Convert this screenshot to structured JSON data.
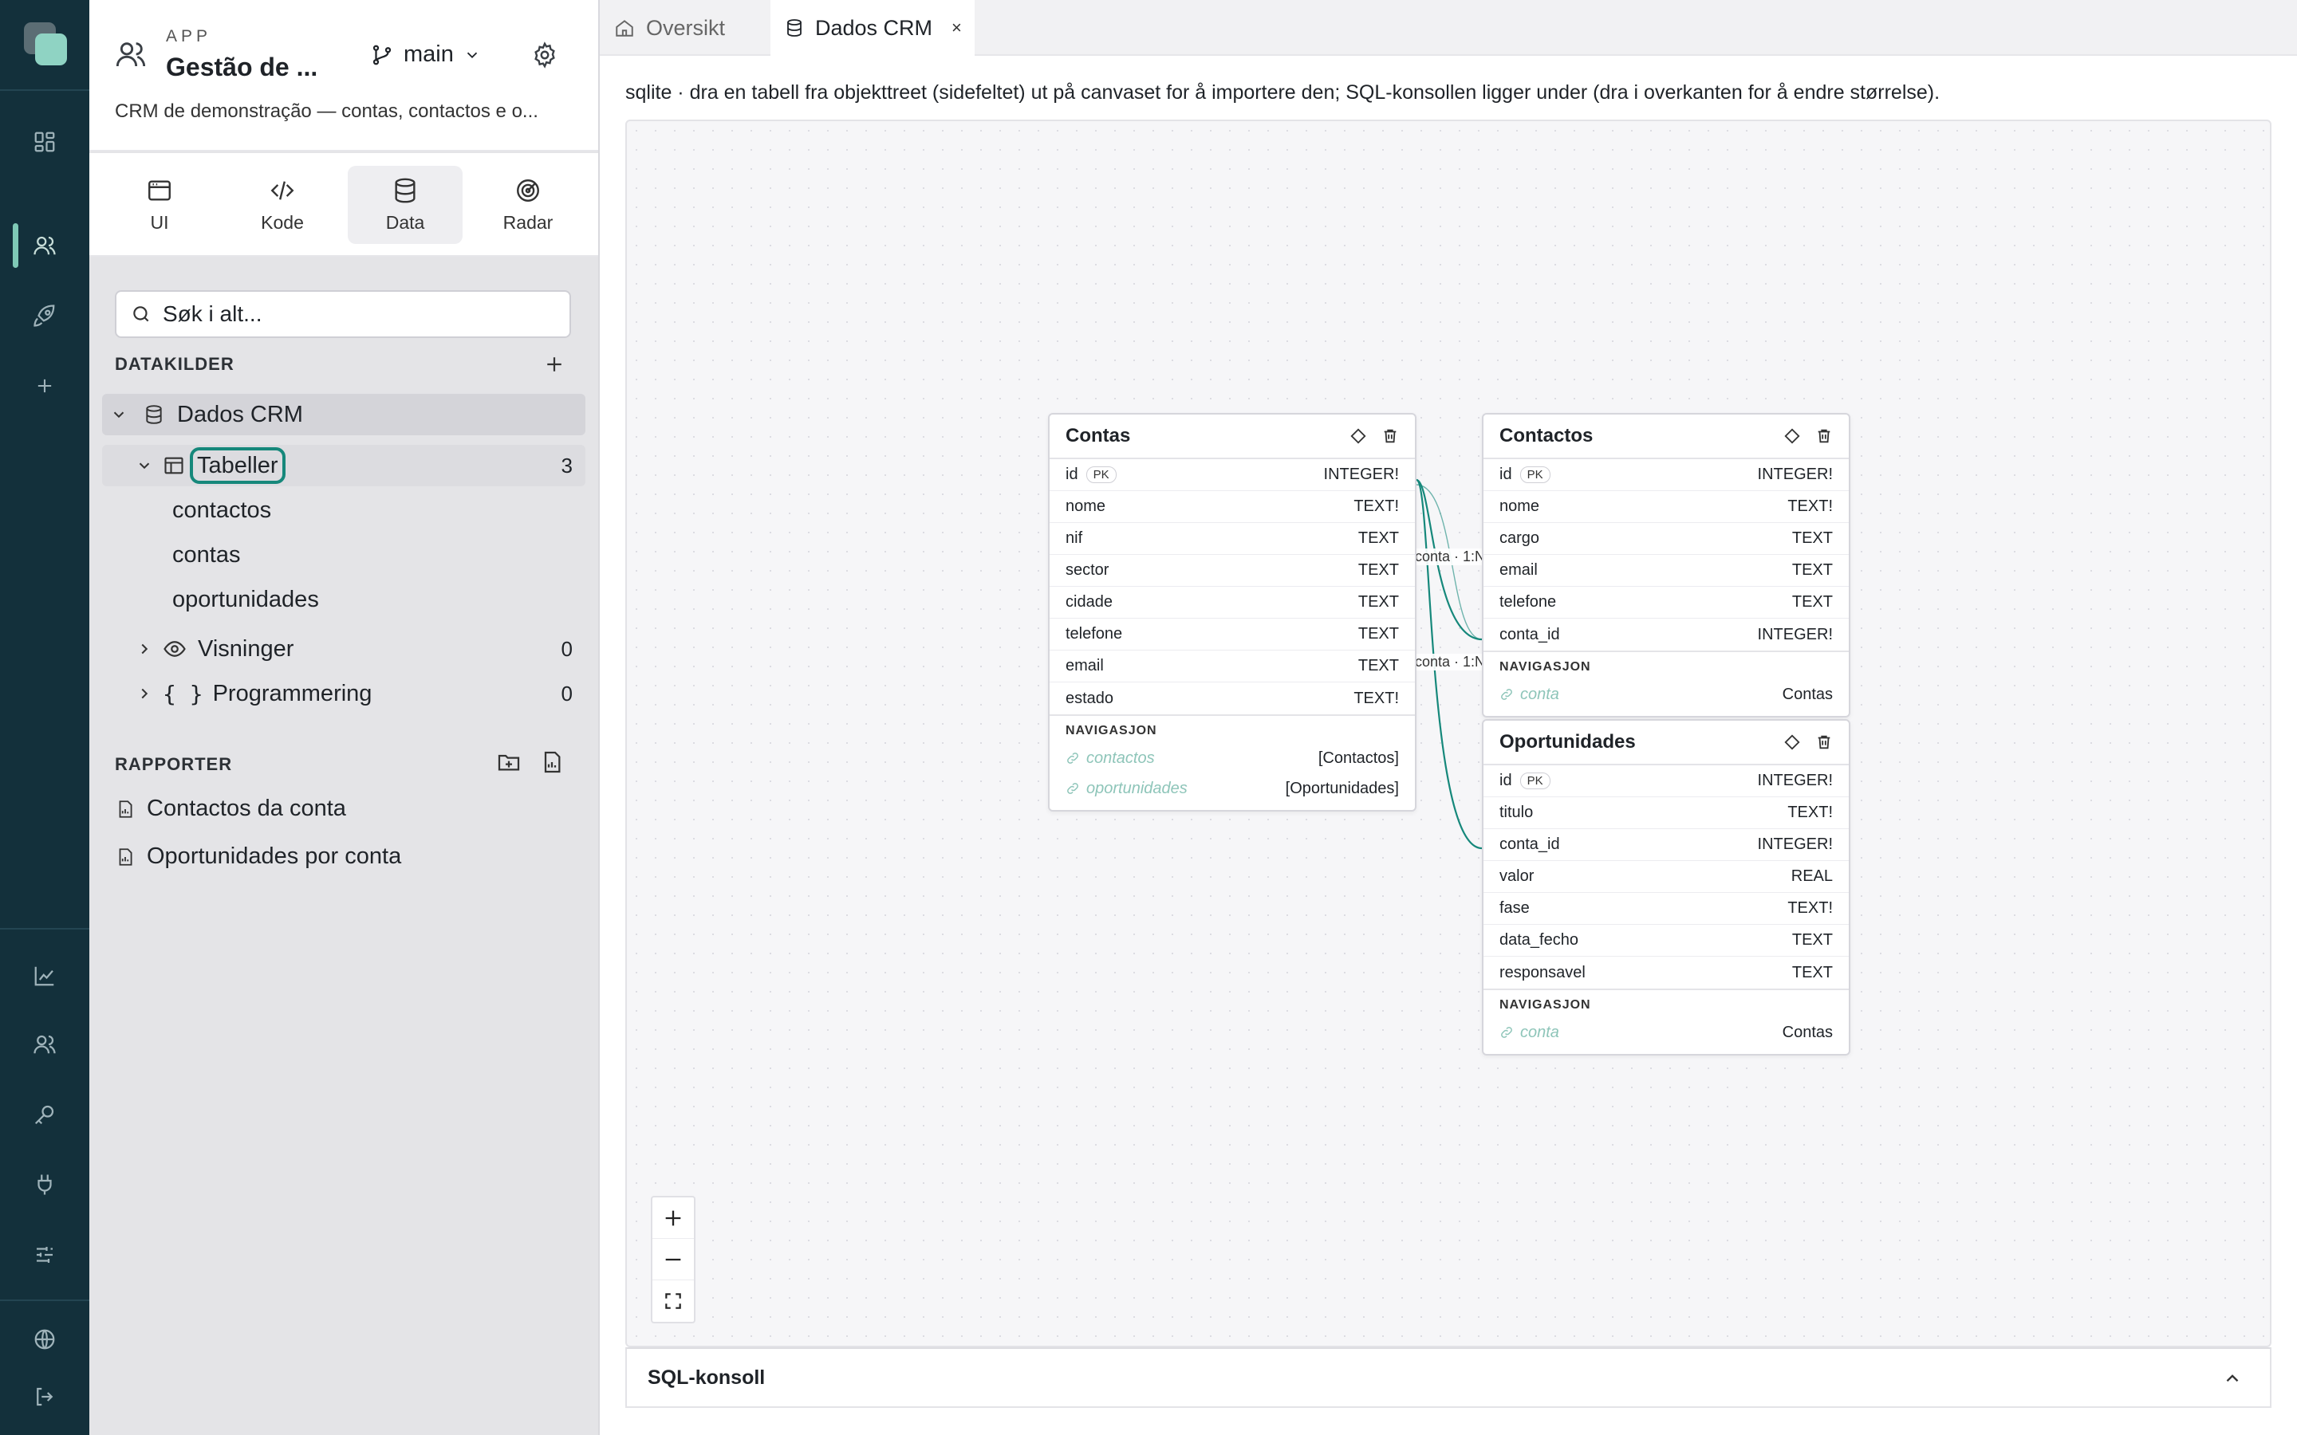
{
  "app": {
    "kicker": "APP",
    "name": "Gestão de ...",
    "branch": "main",
    "description": "CRM de demonstração — contas, contactos e o..."
  },
  "modes": [
    {
      "label": "UI",
      "icon": "window-icon"
    },
    {
      "label": "Kode",
      "icon": "code-icon"
    },
    {
      "label": "Data",
      "icon": "database-icon",
      "active": true
    },
    {
      "label": "Radar",
      "icon": "radar-icon"
    }
  ],
  "search": {
    "placeholder": "Søk i alt..."
  },
  "datasources": {
    "title": "DATAKILDER",
    "source": "Dados CRM",
    "tables_group": {
      "label": "Tabeller",
      "count": "3"
    },
    "tables": [
      "contactos",
      "contas",
      "oportunidades"
    ],
    "views": {
      "label": "Visninger",
      "count": "0"
    },
    "programming": {
      "label": "Programmering",
      "count": "0"
    }
  },
  "reports": {
    "title": "RAPPORTER",
    "items": [
      "Contactos da conta",
      "Oportunidades por conta"
    ]
  },
  "tabs": [
    {
      "label": "Oversikt",
      "icon": "home-icon"
    },
    {
      "label": "Dados CRM",
      "icon": "database-icon",
      "close": "×",
      "active": true
    }
  ],
  "hint": "sqlite · dra en tabell fra objekttreet (sidefeltet) ut på canvaset for å importere den; SQL-konsollen ligger under (dra i overkanten for å endre størrelse).",
  "schema": {
    "pk_label": "PK",
    "nav_title": "NAVIGASJON",
    "tables": {
      "contas": {
        "title": "Contas",
        "fields": [
          {
            "name": "id",
            "type": "INTEGER!",
            "pk": true
          },
          {
            "name": "nome",
            "type": "TEXT!"
          },
          {
            "name": "nif",
            "type": "TEXT"
          },
          {
            "name": "sector",
            "type": "TEXT"
          },
          {
            "name": "cidade",
            "type": "TEXT"
          },
          {
            "name": "telefone",
            "type": "TEXT"
          },
          {
            "name": "email",
            "type": "TEXT"
          },
          {
            "name": "estado",
            "type": "TEXT!"
          }
        ],
        "navigation": [
          {
            "name": "contactos",
            "target": "[Contactos]"
          },
          {
            "name": "oportunidades",
            "target": "[Oportunidades]"
          }
        ]
      },
      "contactos": {
        "title": "Contactos",
        "fields": [
          {
            "name": "id",
            "type": "INTEGER!",
            "pk": true
          },
          {
            "name": "nome",
            "type": "TEXT!"
          },
          {
            "name": "cargo",
            "type": "TEXT"
          },
          {
            "name": "email",
            "type": "TEXT"
          },
          {
            "name": "telefone",
            "type": "TEXT"
          },
          {
            "name": "conta_id",
            "type": "INTEGER!"
          }
        ],
        "navigation": [
          {
            "name": "conta",
            "target": "Contas"
          }
        ]
      },
      "oportunidades": {
        "title": "Oportunidades",
        "fields": [
          {
            "name": "id",
            "type": "INTEGER!",
            "pk": true
          },
          {
            "name": "titulo",
            "type": "TEXT!"
          },
          {
            "name": "conta_id",
            "type": "INTEGER!"
          },
          {
            "name": "valor",
            "type": "REAL"
          },
          {
            "name": "fase",
            "type": "TEXT!"
          },
          {
            "name": "data_fecho",
            "type": "TEXT"
          },
          {
            "name": "responsavel",
            "type": "TEXT"
          }
        ],
        "navigation": [
          {
            "name": "conta",
            "target": "Contas"
          }
        ]
      }
    },
    "relations": [
      {
        "label": "conta · 1:N"
      },
      {
        "label": "conta · 1:N"
      }
    ]
  },
  "sql_console": {
    "label": "SQL-konsoll"
  },
  "colors": {
    "accent": "#16887b",
    "rail": "#13303b",
    "relation_line": "#16887b"
  }
}
